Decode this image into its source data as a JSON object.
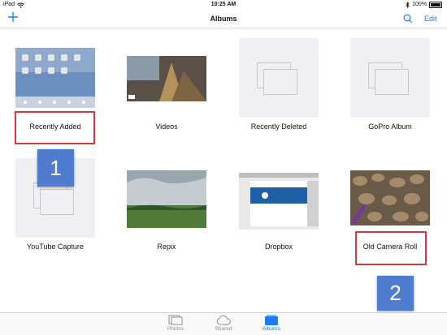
{
  "status_bar": {
    "device": "iPad",
    "time": "10:25 AM",
    "battery": "100%"
  },
  "nav": {
    "title": "Albums",
    "edit_label": "Edit"
  },
  "albums": [
    {
      "label": "Recently Added"
    },
    {
      "label": "Videos"
    },
    {
      "label": "Recently Deleted"
    },
    {
      "label": "GoPro Album"
    },
    {
      "label": "YouTube Capture"
    },
    {
      "label": "Repix"
    },
    {
      "label": "Dropbox"
    },
    {
      "label": "Old Camera Roll"
    }
  ],
  "annotations": {
    "badge1": "1",
    "badge2": "2"
  },
  "tabs": [
    {
      "label": "Photos"
    },
    {
      "label": "Shared"
    },
    {
      "label": "Albums"
    }
  ],
  "colors": {
    "accent": "#1a7cf5",
    "highlight": "#d43b3b",
    "badge": "#4f7ccf"
  }
}
